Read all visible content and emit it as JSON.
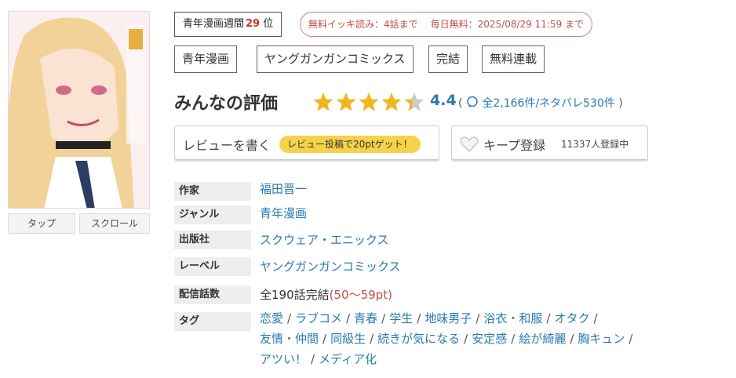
{
  "cover": {
    "buttons": {
      "tap": "タップ",
      "scroll": "スクロール"
    }
  },
  "ranking": {
    "label": "青年漫画週間",
    "rank": "29",
    "suffix": "位"
  },
  "free_info": {
    "read": "無料イッキ読み：4話まで",
    "daily": "毎日無料：2025/08/29 11:59 まで"
  },
  "genre_tags": [
    "青年漫画",
    "ヤングガンガンコミックス",
    "完結",
    "無料連載"
  ],
  "rating": {
    "title": "みんなの評価",
    "score": "4.4",
    "stars_value": 4.4,
    "stars_max": 5,
    "count_text": "全2,166件/ネタバレ530件",
    "colors": {
      "star": "#f2b51e",
      "star_empty": "#cccccc",
      "accent": "#2a7ab0"
    }
  },
  "actions": {
    "review_label": "レビューを書く",
    "review_badge": "レビュー投稿で20ptゲット！",
    "keep_label": "キープ登録",
    "keep_count": "11337人登録中"
  },
  "info": {
    "author_label": "作家",
    "author": "福田晋一",
    "genre_label": "ジャンル",
    "genre": "青年漫画",
    "publisher_label": "出版社",
    "publisher": "スクウェア・エニックス",
    "label_label": "レーベル",
    "label": "ヤングガンガンコミックス",
    "episodes_label": "配信話数",
    "episodes": "全190話完結",
    "episodes_pt": "(50〜59pt)",
    "tags_label": "タグ",
    "tags_row1": [
      "恋愛",
      "ラブコメ",
      "青春",
      "学生",
      "地味男子",
      "浴衣・和服",
      "オタク"
    ],
    "tags_row2": [
      "友情・仲間",
      "同級生",
      "続きが気になる",
      "安定感",
      "絵が綺麗",
      "胸キュン"
    ],
    "tags_row3": [
      "アツい！",
      "メディア化"
    ]
  }
}
